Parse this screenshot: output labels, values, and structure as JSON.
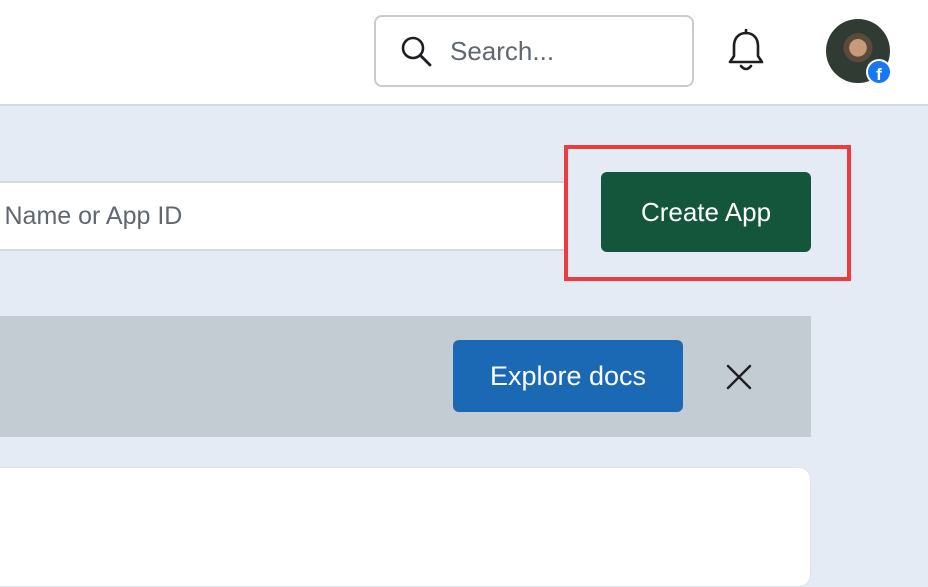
{
  "header": {
    "search": {
      "placeholder": "Search...",
      "icon": "search-icon"
    },
    "notifications_icon": "bell-icon",
    "avatar": {
      "badge_icon": "facebook-icon",
      "badge_color": "#1877f2"
    }
  },
  "apps": {
    "filter": {
      "placeholder_visible": "y App Name or App ID"
    },
    "create_button": {
      "label": "Create App",
      "color": "#13563c"
    },
    "highlight_color": "#ee3b3f"
  },
  "banner": {
    "explore_button": {
      "label": "Explore docs",
      "color": "#1b69b5"
    },
    "close_icon": "close-icon"
  }
}
